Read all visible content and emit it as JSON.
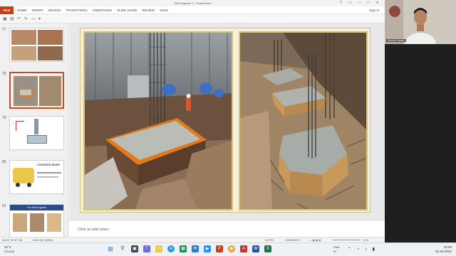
{
  "window": {
    "title": "Site Engineer 2 - PowerPoint"
  },
  "ribbon": {
    "file": "FILE",
    "tabs": [
      "HOME",
      "INSERT",
      "DESIGN",
      "TRANSITIONS",
      "ANIMATIONS",
      "SLIDE SHOW",
      "REVIEW",
      "VIEW"
    ],
    "sign_in": "Sign in"
  },
  "thumbnails": [
    {
      "number": "77"
    },
    {
      "number": "78"
    },
    {
      "number": "79"
    },
    {
      "number": "80",
      "caption": "CONCRETE MIXER"
    },
    {
      "number": "81",
      "caption": "The Site Engineer"
    }
  ],
  "editor": {
    "notes_placeholder": "Click to add notes"
  },
  "status_bar": {
    "slide_info": "SLIDE 78 OF 106",
    "language": "ENGLISH (INDIA)",
    "notes": "NOTES",
    "comments": "COMMENTS",
    "zoom": "81%"
  },
  "webcam": {
    "name": "Akshay Kadam"
  },
  "taskbar": {
    "temperature": "32°C",
    "condition": "Cloudy",
    "lang_line1": "ENG",
    "lang_line2": "IN",
    "time": "15:08",
    "date": "31-03-2022"
  },
  "colors": {
    "accent": "#c43e1c",
    "slide_bg": "#f6f0d6",
    "formwork": "#e07a1a"
  }
}
